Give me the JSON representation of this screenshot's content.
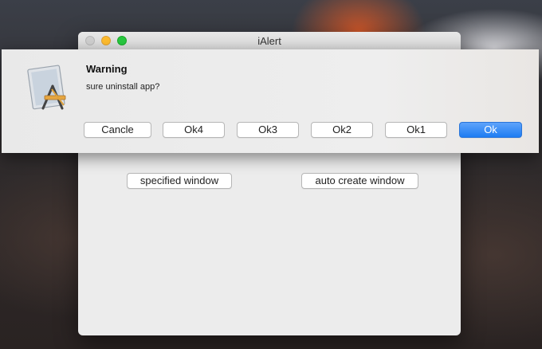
{
  "window": {
    "title": "iAlert",
    "buttons": {
      "specified": "specified window",
      "auto_create": "auto create window"
    }
  },
  "alert": {
    "title": "Warning",
    "message": "sure uninstall app?",
    "buttons": [
      "Cancle",
      "Ok4",
      "Ok3",
      "Ok2",
      "Ok1",
      "Ok"
    ],
    "default_button": "Ok",
    "icon": "app-installer-icon"
  },
  "colors": {
    "default_button": "#1e7df2",
    "traffic_close": "#cfcfcf",
    "traffic_minimize": "#febc2e",
    "traffic_zoom": "#28c840"
  }
}
